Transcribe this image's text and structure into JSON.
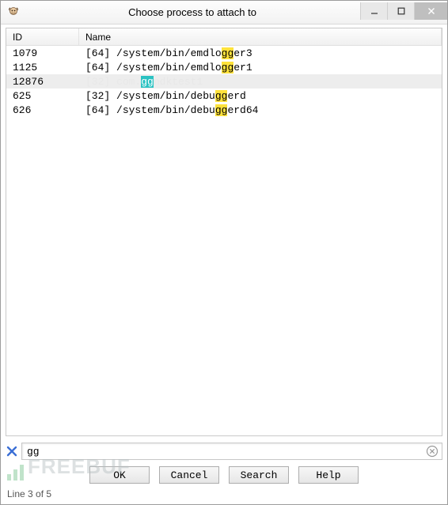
{
  "window": {
    "title": "Choose process to attach to"
  },
  "columns": {
    "id": "ID",
    "name": "Name"
  },
  "search": {
    "query": "gg",
    "value": "gg"
  },
  "processes": [
    {
      "id": "1079",
      "arch": "[64]",
      "name": "/system/bin/emdlogger3",
      "selected": false
    },
    {
      "id": "1125",
      "arch": "[64]",
      "name": "/system/bin/emdlogger1",
      "selected": false
    },
    {
      "id": "12876",
      "arch": "[32]",
      "name": "com.ggndktest1",
      "selected": true
    },
    {
      "id": "625",
      "arch": "[32]",
      "name": "/system/bin/debuggerd",
      "selected": false
    },
    {
      "id": "626",
      "arch": "[64]",
      "name": "/system/bin/debuggerd64",
      "selected": false
    }
  ],
  "buttons": {
    "ok": "OK",
    "cancel": "Cancel",
    "search": "Search",
    "help": "Help"
  },
  "status": {
    "line_template": "Line {current} of {total}",
    "current": 3,
    "total": 5
  },
  "icons": {
    "app": "ida-head-icon",
    "minimize": "minimize-icon",
    "maximize": "maximize-icon",
    "close": "close-icon",
    "clear_query": "clear-x-icon",
    "clear_text": "clear-circle-icon"
  },
  "colors": {
    "highlight": "#ffe23b",
    "highlight_selected": "#2bc2c2",
    "row_selected_bg": "#ededed"
  },
  "watermark": "FREEBUF"
}
